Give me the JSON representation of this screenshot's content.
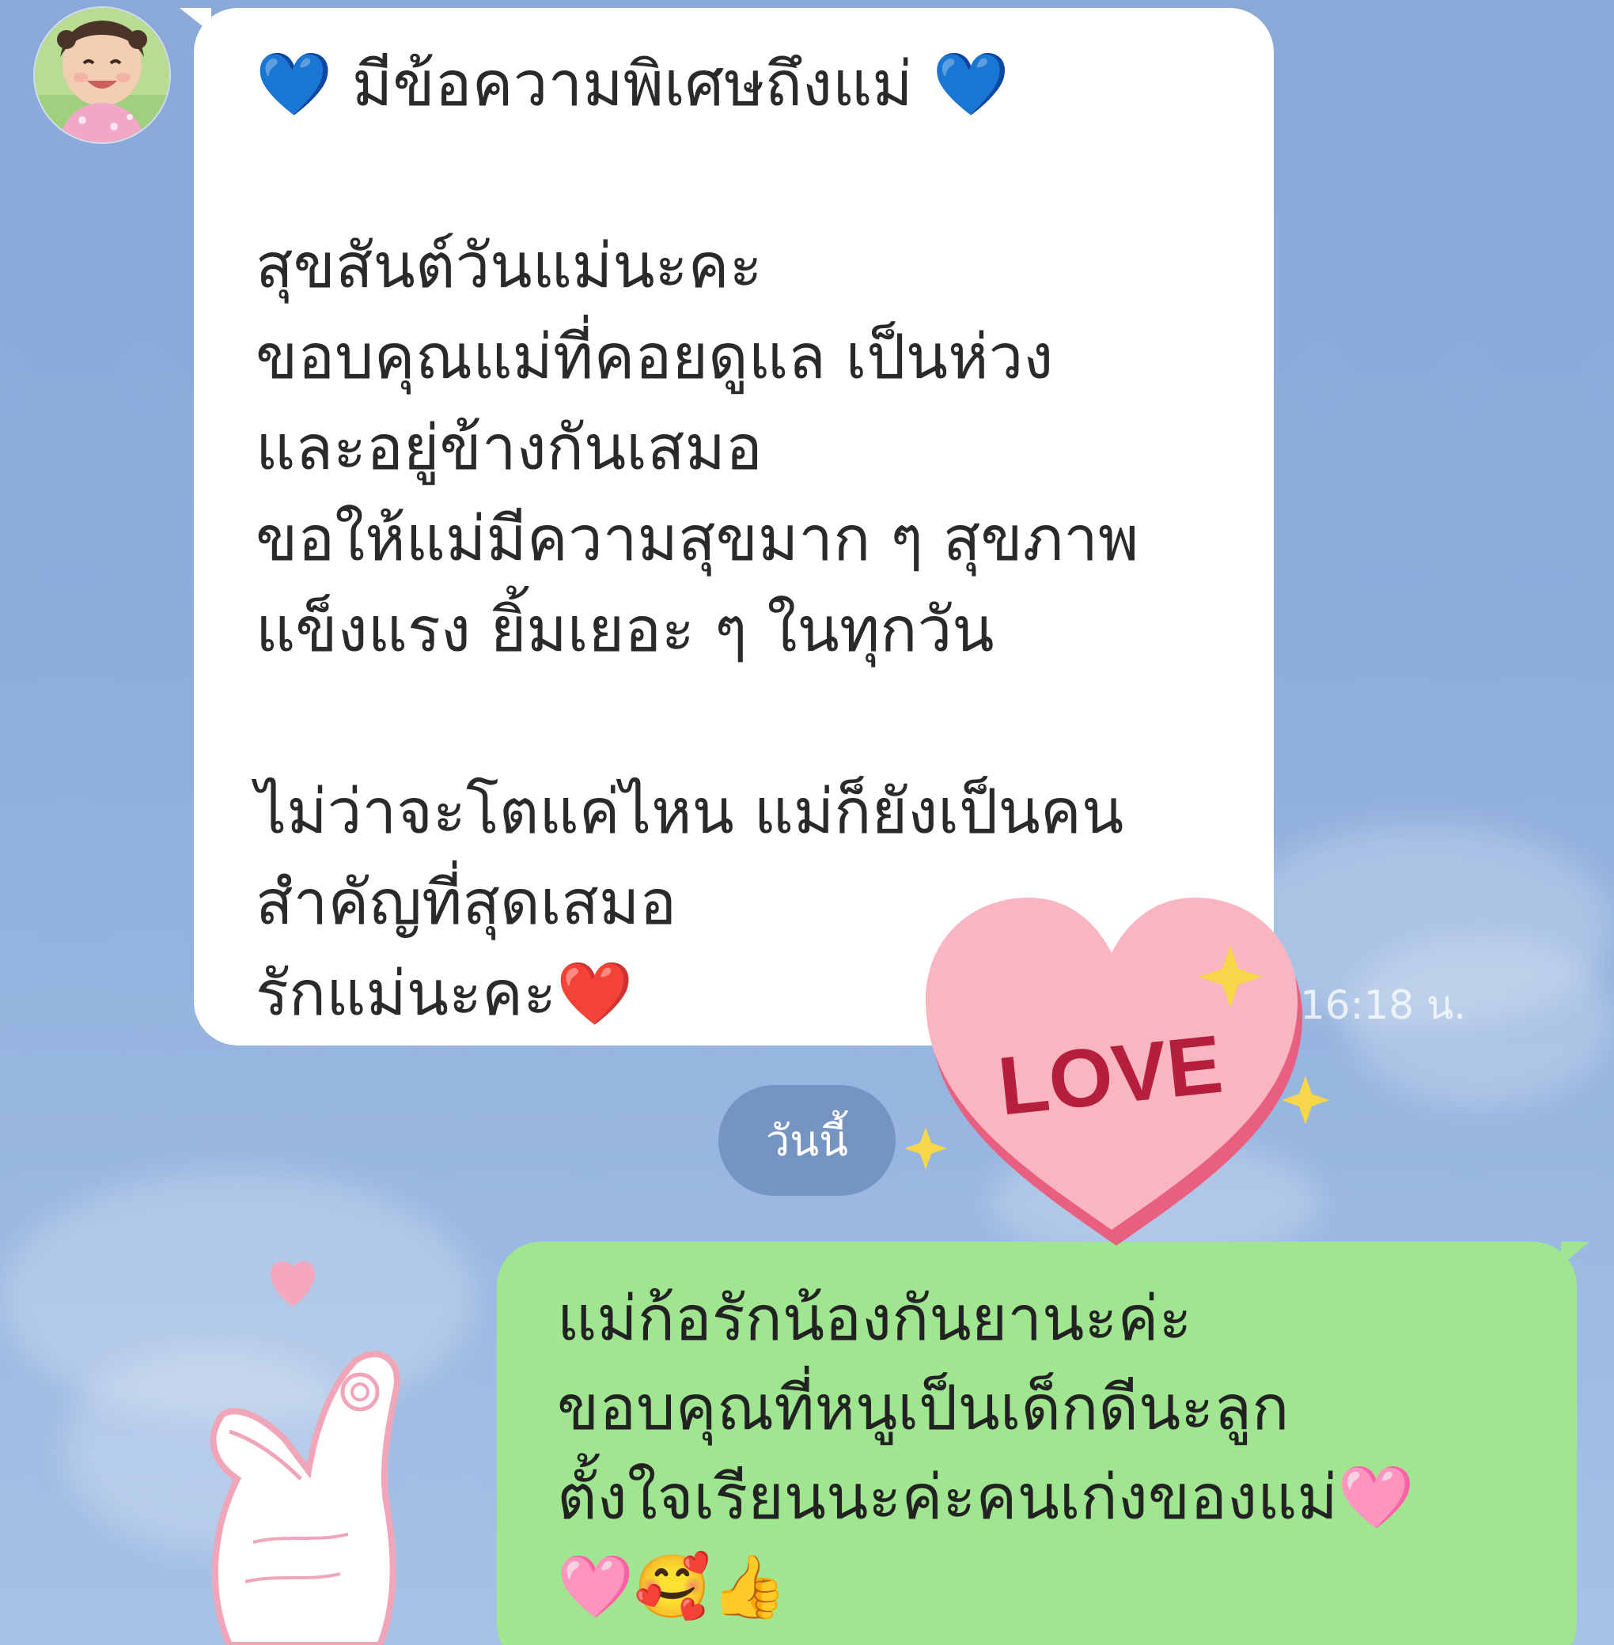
{
  "chat": {
    "incoming": {
      "lines": [
        "💙 มีข้อความพิเศษถึงแม่ 💙",
        "",
        "สุขสันต์วันแม่นะคะ",
        "ขอบคุณแม่ที่คอยดูแล เป็นห่วง",
        "และอยู่ข้างกันเสมอ",
        "ขอให้แม่มีความสุขมาก ๆ สุขภาพ",
        "แข็งแรง ยิ้มเยอะ ๆ ในทุกวัน",
        "",
        "ไม่ว่าจะโตแค่ไหน แม่ก็ยังเป็นคน",
        "สำคัญที่สุดเสมอ",
        "รักแม่นะคะ❤️"
      ],
      "time": "16:18 น."
    },
    "date_separator": "วันนี้",
    "outgoing": {
      "lines": [
        "แม่ก้อรักน้องกันยานะค่ะ",
        "ขอบคุณที่หนูเป็นเด็กดีนะลูก",
        "ตั้งใจเรียนนะค่ะคนเก่งของแม่🩷",
        "🩷🥰👍"
      ]
    },
    "sticker": {
      "heart_text": "LOVE"
    }
  },
  "colors": {
    "background": "#8eaddb",
    "incoming_bubble": "#ffffff",
    "outgoing_bubble": "#a0e590",
    "sticker_heart": "#f9b6c1"
  }
}
